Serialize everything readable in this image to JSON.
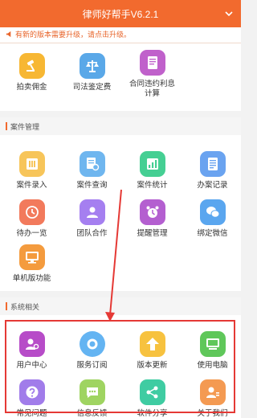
{
  "app": {
    "title": "律师好帮手V6.2.1",
    "menu_icon": "chevron-down-icon"
  },
  "notice": {
    "text": "有新的版本需要升级，请点击升级。"
  },
  "tools": [
    {
      "label": "拍卖佣金",
      "icon": "gavel-icon",
      "color": "#f7b733"
    },
    {
      "label": "司法鉴定费",
      "icon": "scale-icon",
      "color": "#5aa8e8"
    },
    {
      "label": "合同违约利息计算",
      "icon": "document-icon",
      "color": "#c061cb"
    }
  ],
  "case_section": {
    "title": "案件管理"
  },
  "case_items": [
    {
      "label": "案件录入",
      "icon": "case-entry-icon",
      "color": "#f7c55a"
    },
    {
      "label": "案件查询",
      "icon": "case-search-icon",
      "color": "#6fb6ef"
    },
    {
      "label": "案件统计",
      "icon": "chart-icon",
      "color": "#45cf93"
    },
    {
      "label": "办案记录",
      "icon": "record-icon",
      "color": "#6aa3f0"
    },
    {
      "label": "待办一览",
      "icon": "todo-icon",
      "color": "#f27a5c"
    },
    {
      "label": "团队合作",
      "icon": "team-icon",
      "color": "#a57ff0"
    },
    {
      "label": "提醒管理",
      "icon": "alarm-icon",
      "color": "#b45fd0"
    },
    {
      "label": "绑定微信",
      "icon": "wechat-icon",
      "color": "#5aa6ef"
    },
    {
      "label": "单机版功能",
      "icon": "monitor-icon",
      "color": "#f49b3e"
    }
  ],
  "system_section": {
    "title": "系统相关"
  },
  "system_items": [
    {
      "label": "用户中心",
      "icon": "user-center-icon",
      "color": "#b74cc8"
    },
    {
      "label": "服务订阅",
      "icon": "subscription-icon",
      "color": "#64b4f2"
    },
    {
      "label": "版本更新",
      "icon": "upgrade-icon",
      "color": "#f7c23f"
    },
    {
      "label": "使用电脑",
      "icon": "computer-icon",
      "color": "#5fc75a"
    },
    {
      "label": "常见问题",
      "icon": "question-icon",
      "color": "#a17cea"
    },
    {
      "label": "信息反馈",
      "icon": "feedback-icon",
      "color": "#9fd461"
    },
    {
      "label": "软件分享",
      "icon": "share-icon",
      "color": "#3fcca2"
    },
    {
      "label": "关于我们",
      "icon": "about-icon",
      "color": "#f49a52"
    }
  ],
  "colors": {
    "accent": "#f26a2e",
    "highlight": "#e53935"
  }
}
